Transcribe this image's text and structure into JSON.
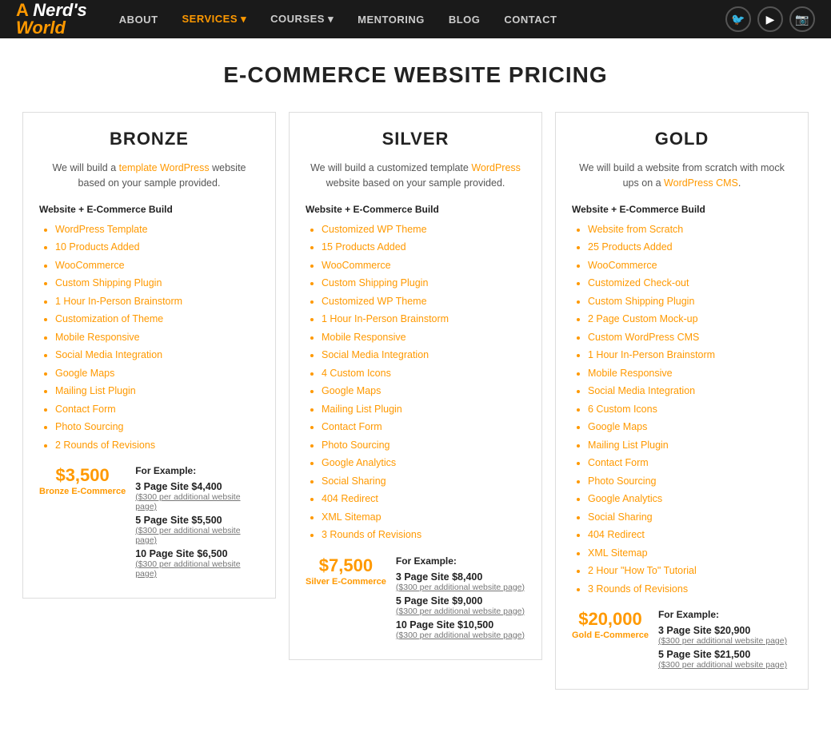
{
  "nav": {
    "logo": {
      "a": "A",
      "nerds": "Nerd's",
      "world": "World"
    },
    "links": [
      {
        "label": "ABOUT",
        "active": false
      },
      {
        "label": "SERVICES ▾",
        "active": true
      },
      {
        "label": "COURSES ▾",
        "active": false
      },
      {
        "label": "MENTORING",
        "active": false
      },
      {
        "label": "BLOG",
        "active": false
      },
      {
        "label": "CONTACT",
        "active": false
      }
    ],
    "icons": [
      "🐦",
      "▶",
      "📷"
    ]
  },
  "page_title": "E-COMMERCE WEBSITE PRICING",
  "cards": [
    {
      "id": "bronze",
      "title": "BRONZE",
      "desc_plain": "We will build a ",
      "desc_link": "template WordPress",
      "desc_end": " website based on your sample provided.",
      "section_label": "Website + E-Commerce Build",
      "features": [
        "WordPress Template",
        "10 Products Added",
        "WooCommerce",
        "Custom Shipping Plugin",
        "1 Hour In-Person Brainstorm",
        "Customization of Theme",
        "Mobile Responsive",
        "Social Media Integration",
        "Google Maps",
        "Mailing List Plugin",
        "Contact Form",
        "Photo Sourcing",
        "2 Rounds of Revisions"
      ],
      "price": "$3,500",
      "price_label": "Bronze E-Commerce",
      "for_example_label": "For Example:",
      "price_tiers": [
        {
          "name": "3 Page Site $4,400",
          "note": "($300 per additional website page)"
        },
        {
          "name": "5 Page Site $5,500",
          "note": "($300 per additional website page)"
        },
        {
          "name": "10 Page Site $6,500",
          "note": "($300 per additional website page)"
        }
      ]
    },
    {
      "id": "silver",
      "title": "SILVER",
      "desc_plain": "We will build a customized template ",
      "desc_link": "WordPress",
      "desc_end": " website based on your sample provided.",
      "section_label": "Website + E-Commerce Build",
      "features": [
        "Customized WP Theme",
        "15 Products Added",
        "WooCommerce",
        "Custom Shipping Plugin",
        "Customized WP Theme",
        "1 Hour In-Person Brainstorm",
        "Mobile Responsive",
        "Social Media Integration",
        "4 Custom Icons",
        "Google Maps",
        "Mailing List Plugin",
        "Contact Form",
        "Photo Sourcing",
        "Google Analytics",
        "Social Sharing",
        "404 Redirect",
        "XML Sitemap",
        "3 Rounds of Revisions"
      ],
      "price": "$7,500",
      "price_label": "Silver E-Commerce",
      "for_example_label": "For Example:",
      "price_tiers": [
        {
          "name": "3 Page Site $8,400",
          "note": "($300 per additional website page)"
        },
        {
          "name": "5 Page Site $9,000",
          "note": "($300 per additional website page)"
        },
        {
          "name": "10 Page Site $10,500",
          "note": "($300 per additional website page)"
        }
      ]
    },
    {
      "id": "gold",
      "title": "GOLD",
      "desc_plain": "We will build a website from scratch with mock ups on a ",
      "desc_link": "WordPress CMS",
      "desc_end": ".",
      "section_label": "Website + E-Commerce Build",
      "features": [
        "Website from Scratch",
        "25 Products Added",
        "WooCommerce",
        "Customized Check-out",
        "Custom Shipping Plugin",
        "2 Page Custom Mock-up",
        "Custom WordPress CMS",
        "1 Hour In-Person Brainstorm",
        "Mobile Responsive",
        "Social Media Integration",
        "6 Custom Icons",
        "Google Maps",
        "Mailing List Plugin",
        "Contact Form",
        "Photo Sourcing",
        "Google Analytics",
        "Social Sharing",
        "404 Redirect",
        "XML Sitemap",
        "2 Hour \"How To\" Tutorial",
        "3 Rounds of Revisions"
      ],
      "price": "$20,000",
      "price_label": "Gold E-Commerce",
      "for_example_label": "For Example:",
      "price_tiers": [
        {
          "name": "3 Page Site $20,900",
          "note": "($300 per additional website page)"
        },
        {
          "name": "5 Page Site $21,500",
          "note": "($300 per additional website page)"
        }
      ]
    }
  ]
}
